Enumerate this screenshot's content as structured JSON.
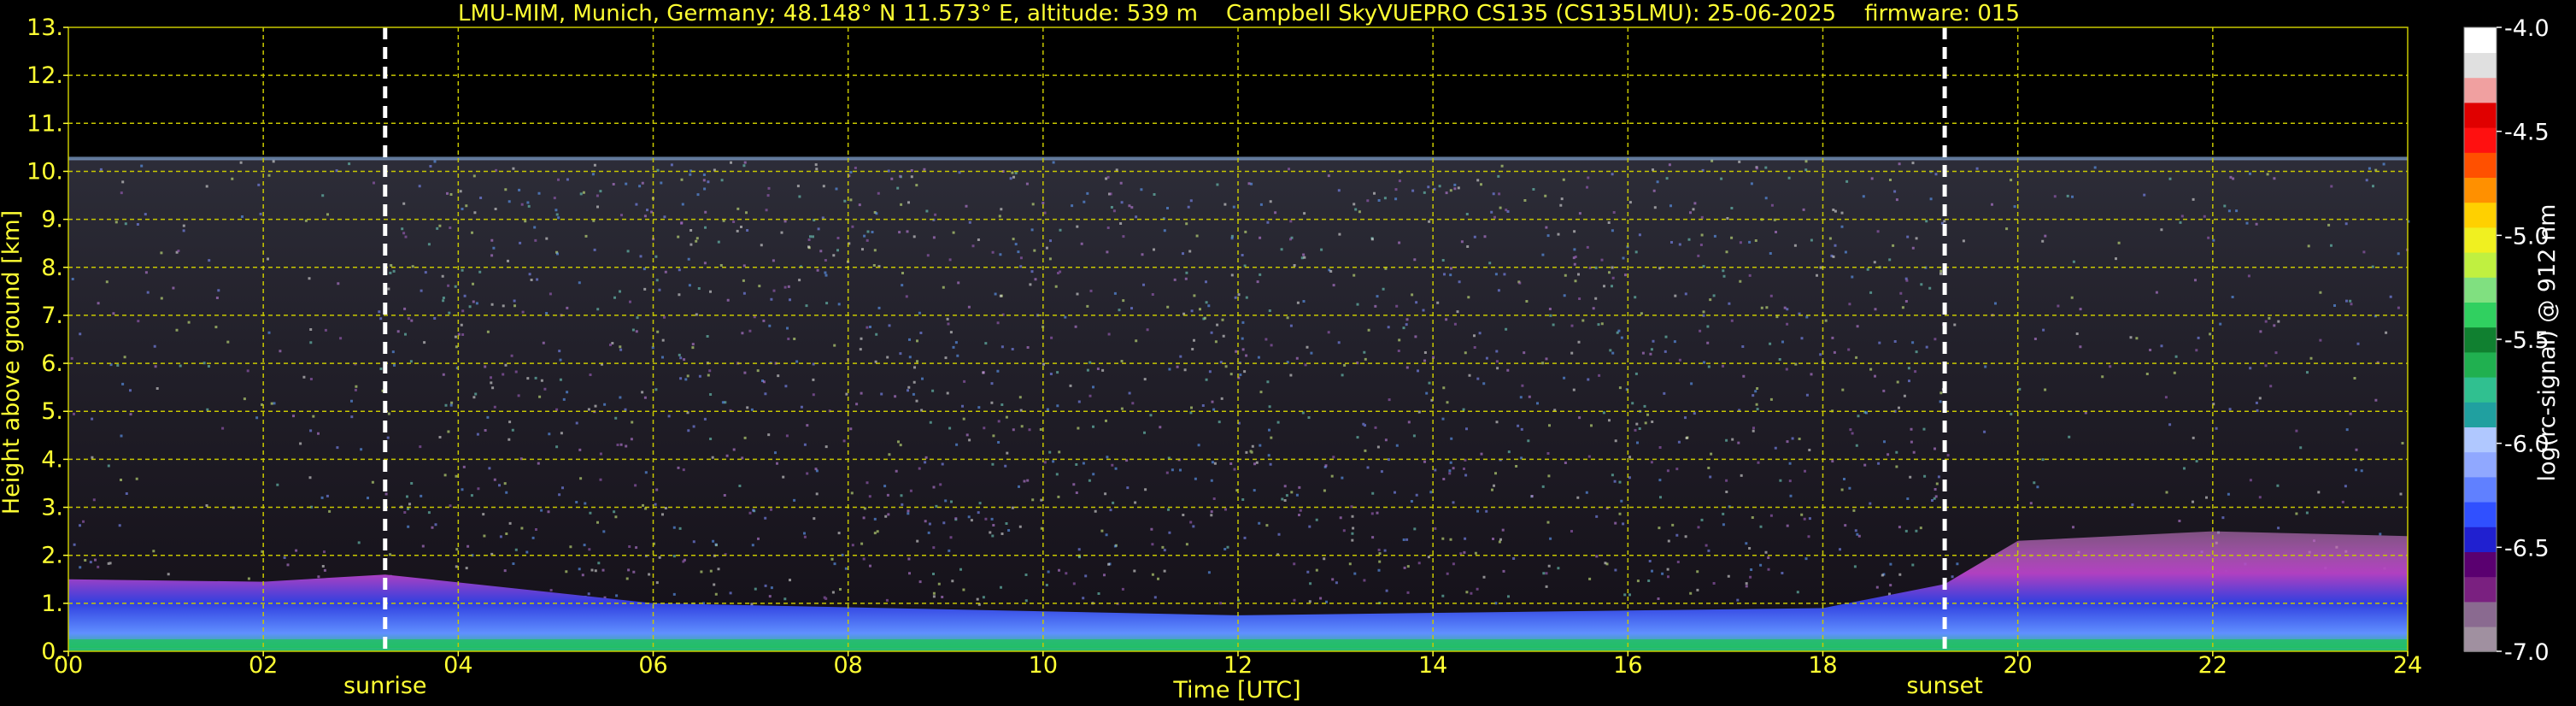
{
  "chart_data": {
    "type": "heatmap",
    "title": "LMU-MIM, Munich, Germany; 48.148° N 11.573° E, altitude: 539 m    Campbell SkyVUEPRO CS135 (CS135LMU): 25-06-2025    firmware: 015",
    "xlabel": "Time [UTC]",
    "ylabel": "Height above ground [km]",
    "xlim": [
      0,
      24
    ],
    "ylim": [
      0,
      13
    ],
    "x_ticks": [
      "00",
      "02",
      "04",
      "06",
      "08",
      "10",
      "12",
      "14",
      "16",
      "18",
      "20",
      "22",
      "24"
    ],
    "x_tick_values": [
      0,
      2,
      4,
      6,
      8,
      10,
      12,
      14,
      16,
      18,
      20,
      22,
      24
    ],
    "y_ticks": [
      "0.",
      "1.",
      "2.",
      "3.",
      "4.",
      "5.",
      "6.",
      "7.",
      "8.",
      "9.",
      "10.",
      "11.",
      "12.",
      "13."
    ],
    "y_tick_values": [
      0,
      1,
      2,
      3,
      4,
      5,
      6,
      7,
      8,
      9,
      10,
      11,
      12,
      13
    ],
    "grid": true,
    "max_range_km": 10.25,
    "events": [
      {
        "label": "sunrise",
        "time": 3.25
      },
      {
        "label": "sunset",
        "time": 19.25
      }
    ],
    "boundary_layer_top_km": [
      {
        "t": 0,
        "h": 1.5
      },
      {
        "t": 2,
        "h": 1.45
      },
      {
        "t": 3.25,
        "h": 1.6
      },
      {
        "t": 6,
        "h": 1.0
      },
      {
        "t": 12,
        "h": 0.75
      },
      {
        "t": 18,
        "h": 0.9
      },
      {
        "t": 19.25,
        "h": 1.4
      },
      {
        "t": 20,
        "h": 2.3
      },
      {
        "t": 22,
        "h": 2.5
      },
      {
        "t": 24,
        "h": 2.4
      }
    ],
    "colorbar": {
      "label": "log(rc-signal) @ 912 nm",
      "min": -7.0,
      "max": -4.0,
      "ticks": [
        "-4.0",
        "-4.5",
        "-5.0",
        "-5.5",
        "-6.0",
        "-6.5",
        "-7.0"
      ],
      "tick_values": [
        -4.0,
        -4.5,
        -5.0,
        -5.5,
        -6.0,
        -6.5,
        -7.0
      ],
      "colors": [
        "#a090a0",
        "#8a6a90",
        "#7a2080",
        "#5a0070",
        "#2020d0",
        "#3050ff",
        "#6080ff",
        "#90a8ff",
        "#b0c8ff",
        "#20a0a0",
        "#30c090",
        "#20b050",
        "#108030",
        "#30d060",
        "#80e080",
        "#c0f040",
        "#f0f020",
        "#ffd000",
        "#ff9000",
        "#ff5000",
        "#ff1010",
        "#e00000",
        "#f0a0a0",
        "#e0e0e0",
        "#ffffff"
      ]
    }
  },
  "colors": {
    "text": "#ffff33",
    "grid": "#c8c800",
    "background": "#000000"
  }
}
